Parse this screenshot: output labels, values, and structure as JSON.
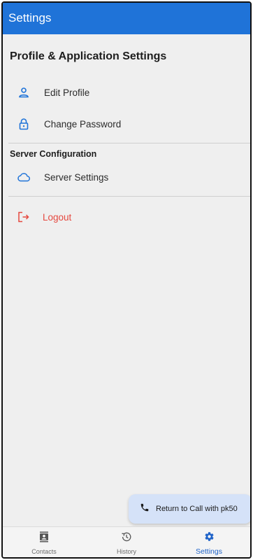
{
  "appbar": {
    "title": "Settings"
  },
  "profile_section": {
    "title": "Profile & Application Settings",
    "items": [
      {
        "label": "Edit Profile",
        "icon": "person-icon"
      },
      {
        "label": "Change Password",
        "icon": "lock-icon"
      }
    ]
  },
  "server_section": {
    "title": "Server Configuration",
    "items": [
      {
        "label": "Server Settings",
        "icon": "cloud-icon"
      }
    ]
  },
  "logout": {
    "label": "Logout",
    "icon": "logout-icon"
  },
  "call_banner": {
    "label": "Return to Call with pk50",
    "icon": "phone-icon"
  },
  "bottom_nav": {
    "items": [
      {
        "label": "Contacts",
        "icon": "contacts-icon",
        "active": false
      },
      {
        "label": "History",
        "icon": "history-icon",
        "active": false
      },
      {
        "label": "Settings",
        "icon": "gear-icon",
        "active": true
      }
    ]
  },
  "colors": {
    "primary": "#1f73d8",
    "background": "#efefef",
    "danger": "#e5483f",
    "active_nav": "#1f63c8",
    "call_pill": "#d5e2f8"
  }
}
